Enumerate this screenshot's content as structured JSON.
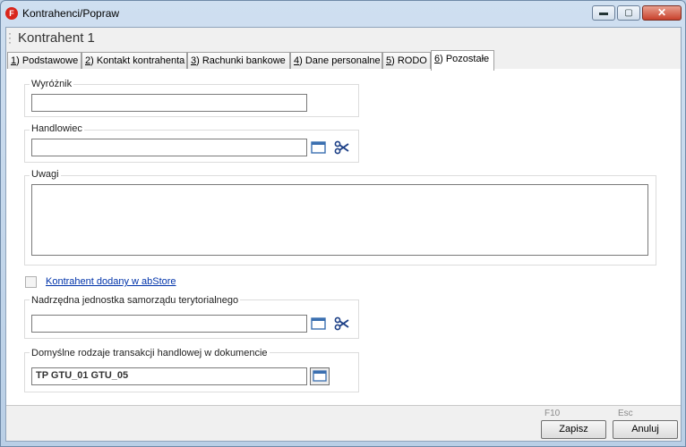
{
  "window": {
    "app_icon_letter": "F",
    "title": "Kontrahenci/Popraw",
    "controls": {
      "minimize": "▬",
      "maximize": "▢",
      "close": "✕"
    }
  },
  "header": {
    "title": "Kontrahent 1"
  },
  "tabs": [
    {
      "hotkey": "1",
      "label": ") Podstawowe"
    },
    {
      "hotkey": "2",
      "label": ") Kontakt kontrahenta"
    },
    {
      "hotkey": "3",
      "label": ") Rachunki bankowe"
    },
    {
      "hotkey": "4",
      "label": ") Dane personalne"
    },
    {
      "hotkey": "5",
      "label": ") RODO"
    },
    {
      "hotkey": "6",
      "label": ") Pozostałe"
    }
  ],
  "active_tab": "6) Pozostałe",
  "form": {
    "wyroznik": {
      "label": "Wyróżnik",
      "value": ""
    },
    "handlowiec": {
      "label": "Handlowiec",
      "value": ""
    },
    "uwagi": {
      "label": "Uwagi",
      "value": ""
    },
    "abstore": {
      "label": "Kontrahent dodany w abStore",
      "checked": false
    },
    "jst": {
      "label": "Nadrzędna jednostka samorządu terytorialnego",
      "value": ""
    },
    "transakcje": {
      "label": "Domyślne rodzaje transakcji handlowej w dokumencie",
      "value": "TP GTU_01 GTU_05"
    }
  },
  "footer": {
    "save": {
      "hotkey": "F10",
      "label": "Zapisz"
    },
    "cancel": {
      "hotkey": "Esc",
      "label": "Anuluj"
    }
  },
  "icons": {
    "folder_color": "#3a6fb0",
    "scissors_color": "#1c3f86"
  }
}
